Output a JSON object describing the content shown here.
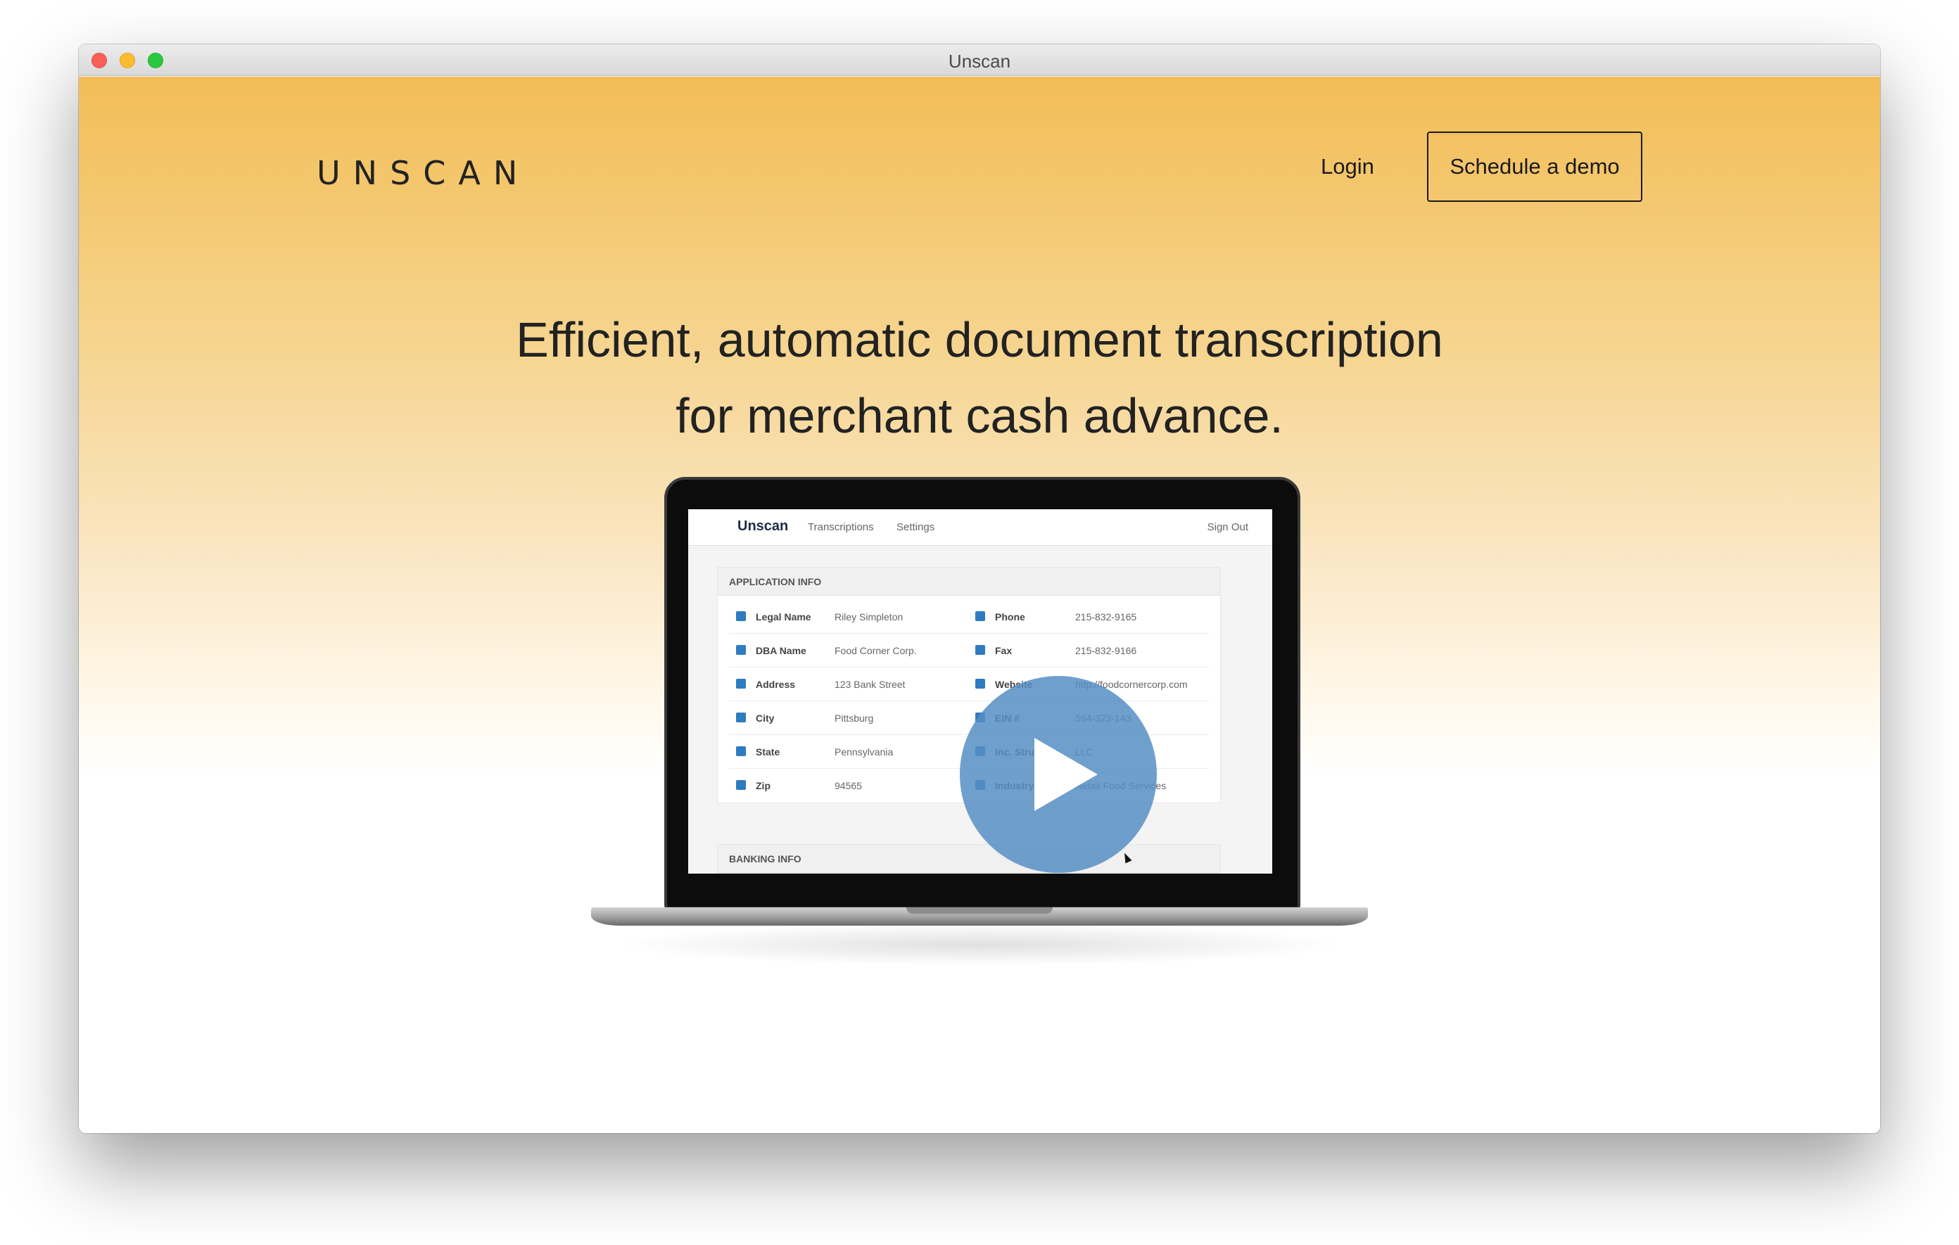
{
  "window": {
    "title": "Unscan"
  },
  "nav": {
    "logo": "UNSCAN",
    "login_label": "Login",
    "demo_label": "Schedule a demo"
  },
  "hero": {
    "line1": "Efficient, automatic document transcription",
    "line2": "for merchant cash advance."
  },
  "app": {
    "brand": "Unscan",
    "links": [
      "Transcriptions",
      "Settings"
    ],
    "signout": "Sign Out",
    "panel1": {
      "title": "APPLICATION INFO",
      "left": [
        {
          "label": "Legal Name",
          "value": "Riley Simpleton",
          "icon": "user-icon"
        },
        {
          "label": "DBA Name",
          "value": "Food Corner Corp.",
          "icon": "envelope-icon"
        },
        {
          "label": "Address",
          "value": "123 Bank Street",
          "icon": "home-icon"
        },
        {
          "label": "City",
          "value": "Pittsburg",
          "icon": "phone-icon"
        },
        {
          "label": "State",
          "value": "Pennsylvania",
          "icon": "flag-icon"
        },
        {
          "label": "Zip",
          "value": "94565",
          "icon": "flag-icon"
        }
      ],
      "right": [
        {
          "label": "Phone",
          "value": "215-832-9165",
          "icon": "phone-icon"
        },
        {
          "label": "Fax",
          "value": "215-832-9166",
          "icon": "envelope-icon"
        },
        {
          "label": "Website",
          "value": "http://foodcornercorp.com",
          "icon": "globe-icon"
        },
        {
          "label": "EIN #",
          "value": "564-323-143",
          "icon": "phone-icon"
        },
        {
          "label": "Inc. Structure",
          "value": "LLC",
          "icon": "flag-icon"
        },
        {
          "label": "Industry Type",
          "value": "Retail Food Services",
          "icon": "flag-icon"
        }
      ]
    },
    "panel2": {
      "title": "BANKING INFO"
    }
  },
  "colors": {
    "gradient_top": "#f2bd56",
    "accent_blue": "#2f7bbf",
    "play_button": "#568ec4"
  }
}
